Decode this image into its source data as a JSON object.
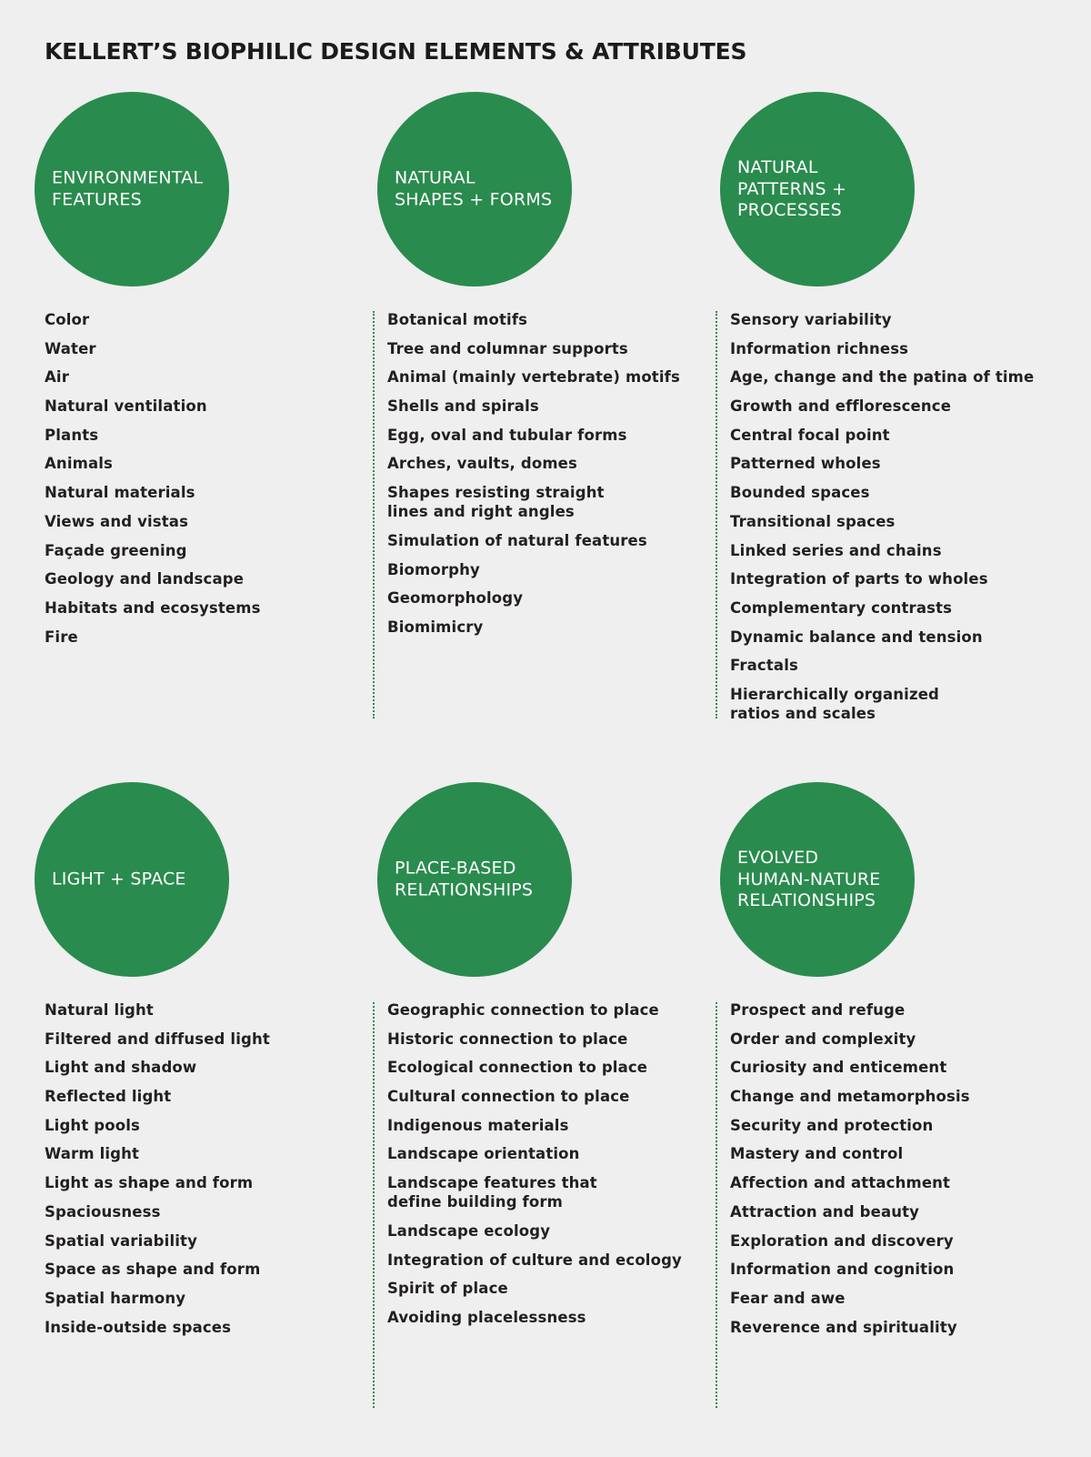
{
  "title": "KELLERT’S BIOPHILIC DESIGN ELEMENTS & ATTRIBUTES",
  "colors": {
    "circle": "#2a8b4e",
    "background": "#efefef",
    "text": "#231f20",
    "divider": "#2a8b4e"
  },
  "categories": [
    {
      "label": "ENVIRONMENTAL\nFEATURES",
      "attributes": [
        "Color",
        "Water",
        "Air",
        "Natural ventilation",
        "Plants",
        "Animals",
        "Natural materials",
        "Views and vistas",
        "Façade greening",
        "Geology and landscape",
        "Habitats and ecosystems",
        "Fire"
      ]
    },
    {
      "label": "NATURAL\nSHAPES + FORMS",
      "attributes": [
        "Botanical motifs",
        "Tree and columnar supports",
        "Animal (mainly vertebrate) motifs",
        "Shells and spirals",
        "Egg, oval and tubular forms",
        "Arches, vaults, domes",
        "Shapes resisting straight\nlines and right angles",
        "Simulation of natural features",
        "Biomorphy",
        "Geomorphology",
        "Biomimicry"
      ]
    },
    {
      "label": "NATURAL\nPATTERNS +\nPROCESSES",
      "attributes": [
        "Sensory variability",
        "Information richness",
        "Age, change and the patina of time",
        "Growth and efflorescence",
        "Central focal point",
        "Patterned wholes",
        "Bounded spaces",
        "Transitional spaces",
        "Linked series and chains",
        "Integration of parts to wholes",
        "Complementary contrasts",
        "Dynamic balance and tension",
        "Fractals",
        "Hierarchically organized\nratios and scales"
      ]
    },
    {
      "label": "LIGHT + SPACE",
      "attributes": [
        "Natural light",
        "Filtered and diffused light",
        "Light and shadow",
        "Reflected light",
        "Light pools",
        "Warm light",
        "Light as shape and form",
        "Spaciousness",
        "Spatial variability",
        "Space as shape and form",
        "Spatial harmony",
        "Inside-outside spaces"
      ]
    },
    {
      "label": "PLACE-BASED\nRELATIONSHIPS",
      "attributes": [
        "Geographic connection to place",
        "Historic connection to place",
        "Ecological connection to place",
        "Cultural connection to place",
        "Indigenous materials",
        "Landscape orientation",
        "Landscape features that\ndefine building form",
        "Landscape ecology",
        "Integration of culture and ecology",
        "Spirit of place",
        "Avoiding placelessness"
      ]
    },
    {
      "label": "EVOLVED\nHUMAN-NATURE\nRELATIONSHIPS",
      "attributes": [
        "Prospect and refuge",
        "Order and complexity",
        "Curiosity and enticement",
        "Change and metamorphosis",
        "Security and protection",
        "Mastery and control",
        "Affection and attachment",
        "Attraction and beauty",
        "Exploration and discovery",
        "Information and cognition",
        "Fear and awe",
        "Reverence and spirituality"
      ]
    }
  ]
}
